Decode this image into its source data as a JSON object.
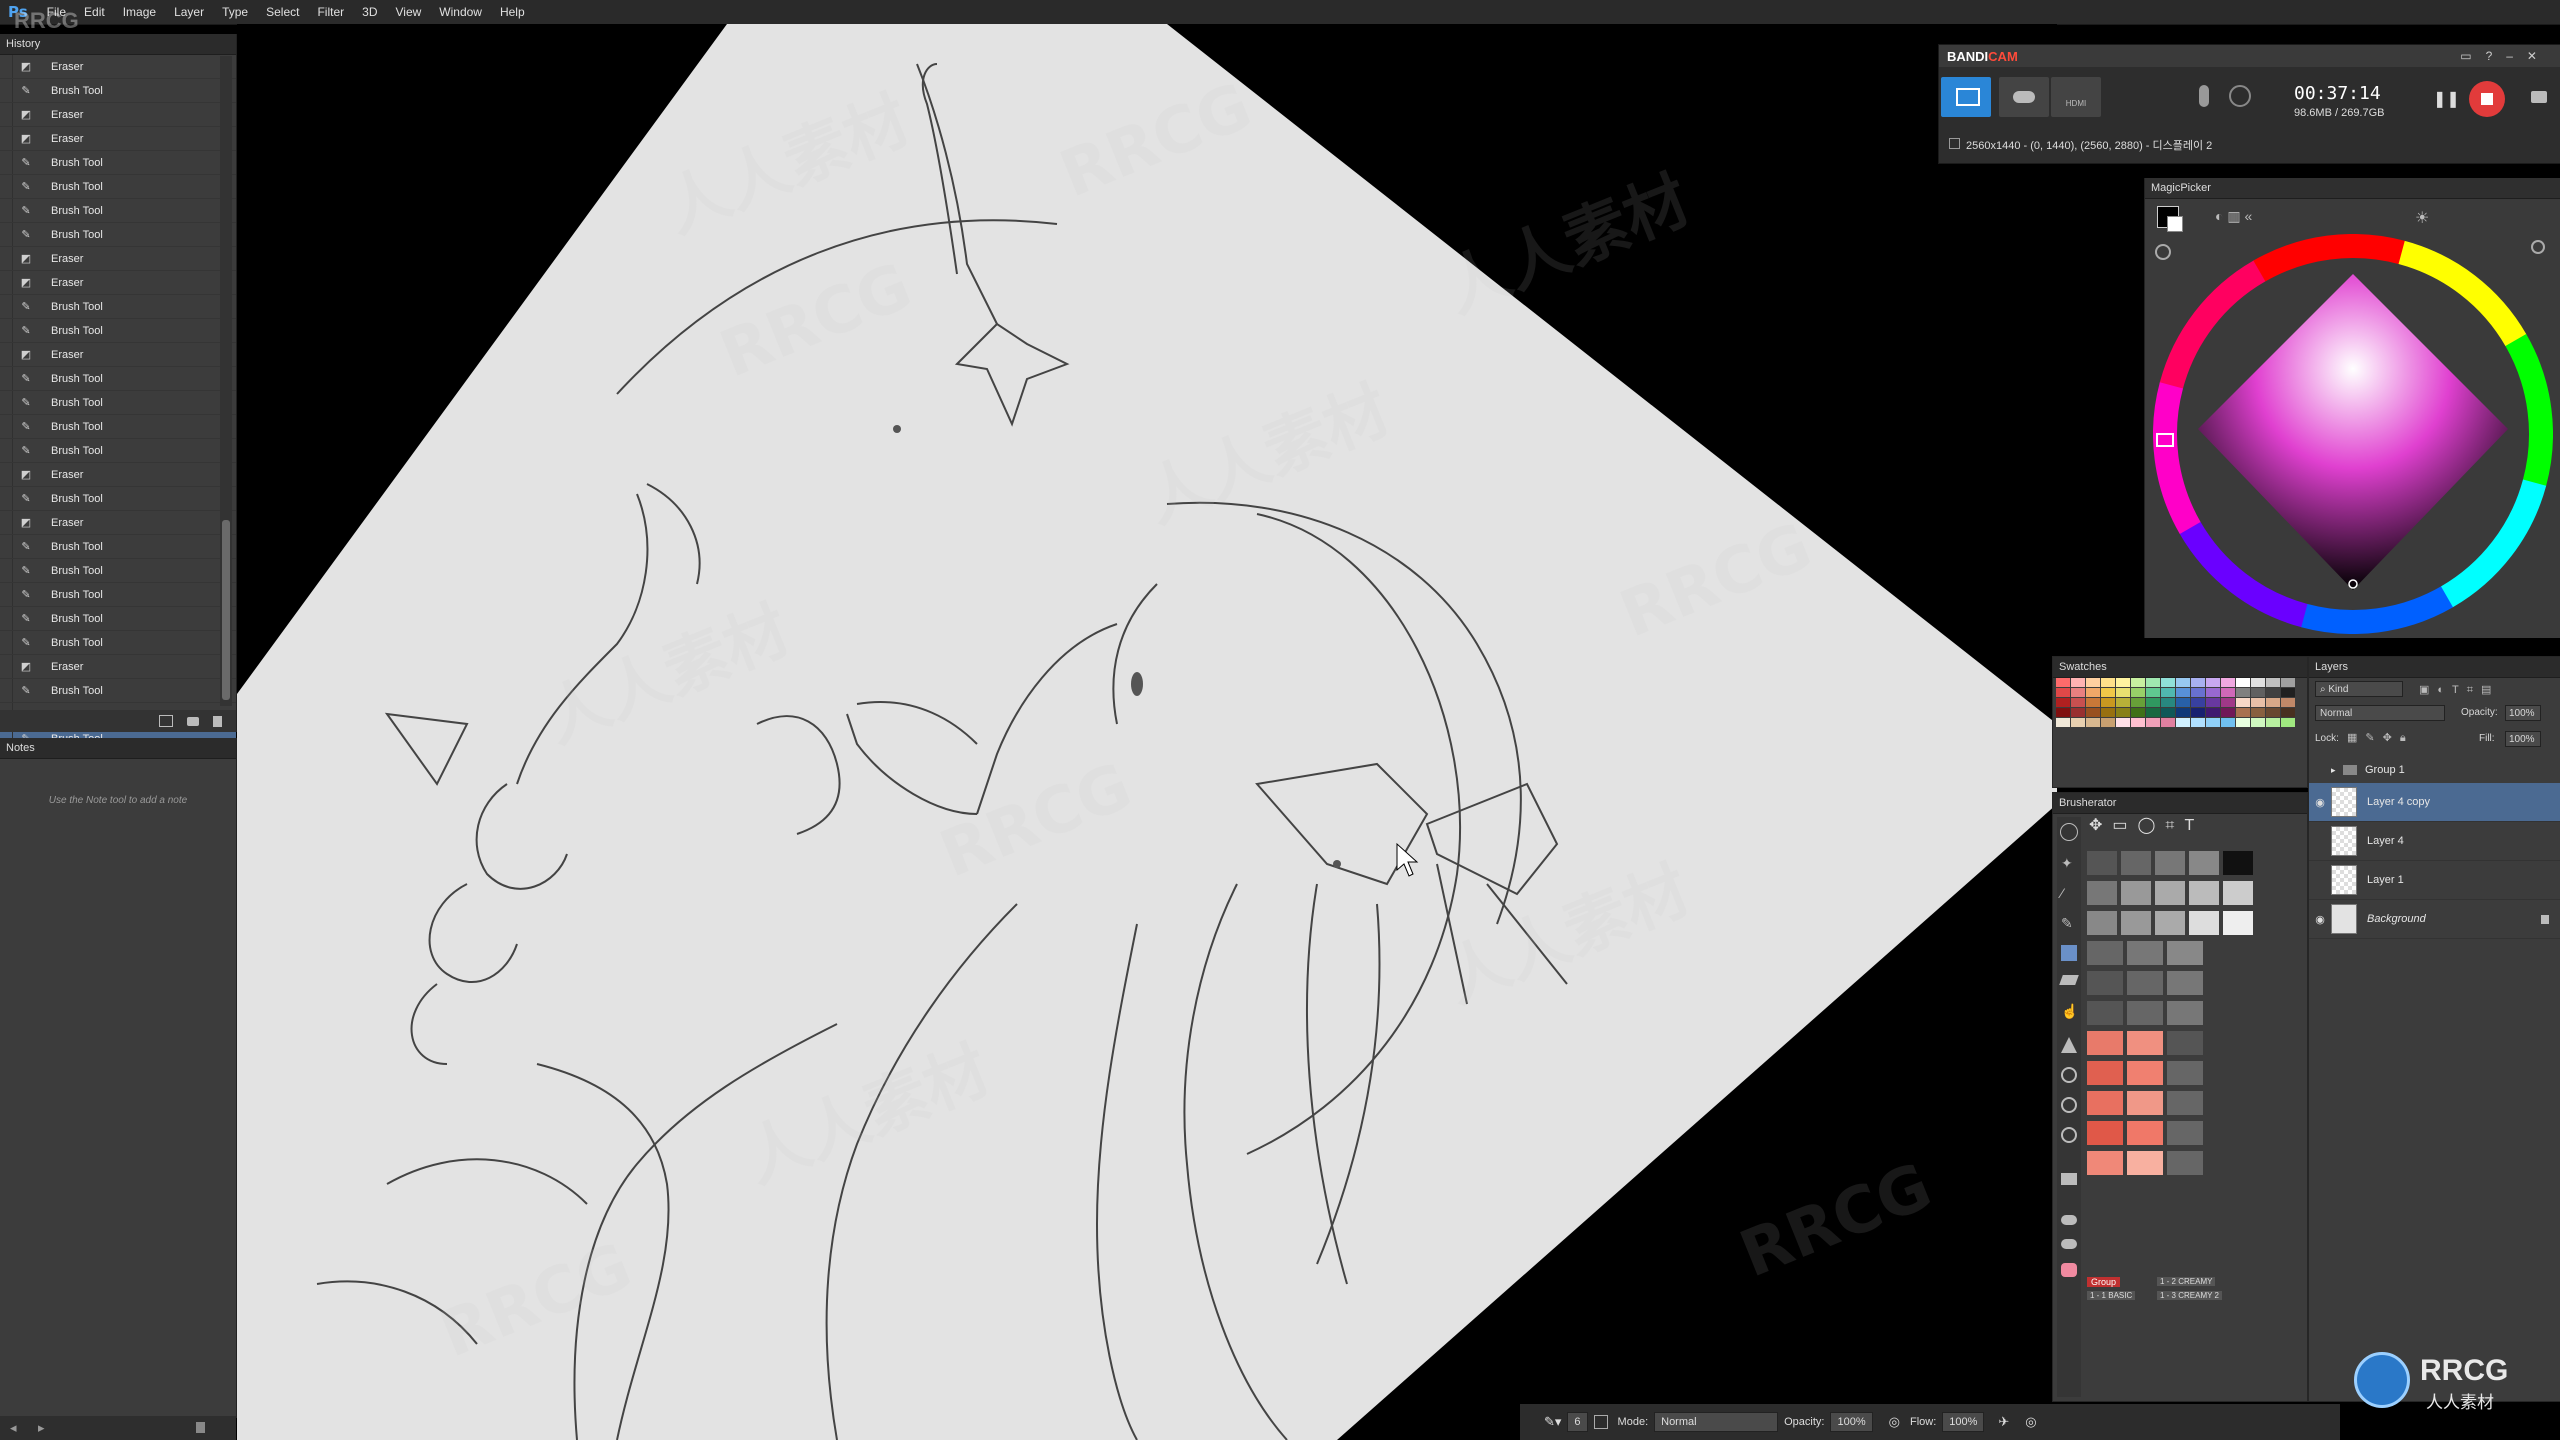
{
  "app": {
    "logo": "Ps",
    "watermark_corner": "RRCG"
  },
  "menu": [
    "File",
    "Edit",
    "Image",
    "Layer",
    "Type",
    "Select",
    "Filter",
    "3D",
    "View",
    "Window",
    "Help"
  ],
  "history": {
    "tab": "History",
    "items": [
      "Eraser",
      "Brush Tool",
      "Eraser",
      "Eraser",
      "Brush Tool",
      "Brush Tool",
      "Brush Tool",
      "Brush Tool",
      "Eraser",
      "Eraser",
      "Brush Tool",
      "Brush Tool",
      "Eraser",
      "Brush Tool",
      "Brush Tool",
      "Brush Tool",
      "Brush Tool",
      "Eraser",
      "Brush Tool",
      "Eraser",
      "Brush Tool",
      "Brush Tool",
      "Brush Tool",
      "Brush Tool",
      "Brush Tool",
      "Eraser",
      "Brush Tool",
      "Eraser",
      "Brush Tool"
    ],
    "selected_index": 28
  },
  "notes": {
    "tab": "Notes",
    "hint": "Use the Note tool to add a note"
  },
  "bandicam": {
    "brand_a": "BANDI",
    "brand_b": "CAM",
    "time": "00:37:14",
    "size": "98.6MB / 269.7GB",
    "region": "2560x1440 - (0, 1440), (2560, 2880) - 디스플레이 2",
    "hdmi_label": "HDMI"
  },
  "magicpicker": {
    "tab": "MagicPicker"
  },
  "swatches": {
    "tab": "Swatches",
    "colors": [
      "#ff6b6b",
      "#ffb3b3",
      "#ffd0a0",
      "#ffe08a",
      "#fff3a0",
      "#c8f0a0",
      "#a0e8b0",
      "#90e0d8",
      "#98c8f0",
      "#a8b0f0",
      "#c8a8f0",
      "#f0a8e0",
      "#ffffff",
      "#e0e0e0",
      "#c0c0c0",
      "#a0a0a0",
      "#e04848",
      "#e88080",
      "#f0a868",
      "#f0c848",
      "#e8e070",
      "#98d068",
      "#60c890",
      "#50b8b0",
      "#5890d8",
      "#6870d0",
      "#9868d0",
      "#d068b8",
      "#808080",
      "#606060",
      "#404040",
      "#202020",
      "#b02020",
      "#c85050",
      "#c87838",
      "#c89820",
      "#b8b038",
      "#68a038",
      "#309860",
      "#288880",
      "#2860a8",
      "#3840a0",
      "#6838a0",
      "#a03888",
      "#f8d8c8",
      "#e8c0a8",
      "#d8a888",
      "#c08868",
      "#801010",
      "#983030",
      "#985020",
      "#987010",
      "#888018",
      "#407018",
      "#186840",
      "#105858",
      "#103878",
      "#182070",
      "#401870",
      "#701858",
      "#a87050",
      "#886040",
      "#684830",
      "#483020",
      "#f0e8d8",
      "#e8d0b0",
      "#d8b890",
      "#c8a070",
      "#ffe0e8",
      "#ffc0d0",
      "#f0a0b8",
      "#e080a0",
      "#d0f0ff",
      "#b0e0ff",
      "#90d0f8",
      "#70c0f0",
      "#e8ffe0",
      "#d0f8c0",
      "#b8f0a0",
      "#a0e880"
    ]
  },
  "brusherator": {
    "tab": "Brusherator",
    "group_label": "Group",
    "presets": [
      "1 - 2 CREAMY",
      "1 - 1 BASIC",
      "1 - 3 CREAMY 2"
    ]
  },
  "layers": {
    "tab": "Layers",
    "kind": "Kind",
    "blend_mode": "Normal",
    "opacity_label": "Opacity:",
    "opacity": "100%",
    "lock_label": "Lock:",
    "fill_label": "Fill:",
    "fill": "100%",
    "items": [
      {
        "name": "Group 1",
        "visible": false,
        "type": "group"
      },
      {
        "name": "Layer 4 copy",
        "visible": true,
        "selected": true
      },
      {
        "name": "Layer 4",
        "visible": false
      },
      {
        "name": "Layer 1",
        "visible": false
      },
      {
        "name": "Background",
        "visible": true,
        "locked": true
      }
    ]
  },
  "options": {
    "brush_size": "6",
    "mode_label": "Mode:",
    "mode": "Normal",
    "opacity_label": "Opacity:",
    "opacity": "100%",
    "flow_label": "Flow:",
    "flow": "100%"
  },
  "canvas_watermarks": [
    "RRCG",
    "人人素材"
  ],
  "corner_logo": {
    "text_a": "RRCG",
    "text_b": "人人素材"
  }
}
